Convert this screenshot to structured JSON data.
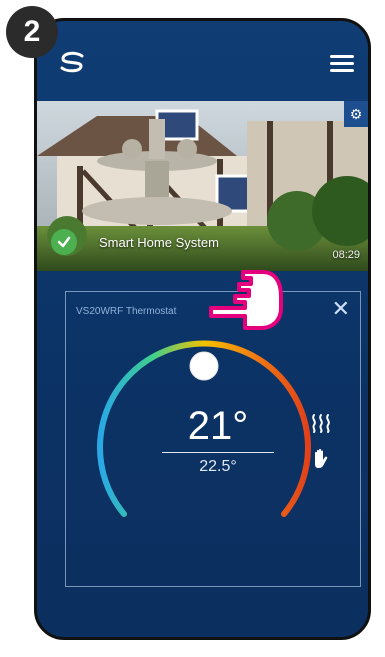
{
  "step": {
    "number": "2"
  },
  "camera": {
    "name": "Smart Home System",
    "time": "08:29"
  },
  "thermostat": {
    "title": "VS20WRF Thermostat",
    "set_temperature": "21°",
    "current_temperature": "22.5°",
    "mode_icons": [
      "heating-icon",
      "manual-mode-icon"
    ]
  },
  "colors": {
    "background": "#0c3366",
    "accent_check": "#4caf50",
    "dial_gradient": [
      "#2aa8e6",
      "#3ecf8e",
      "#f2c200",
      "#f07a14",
      "#e1411a"
    ]
  }
}
